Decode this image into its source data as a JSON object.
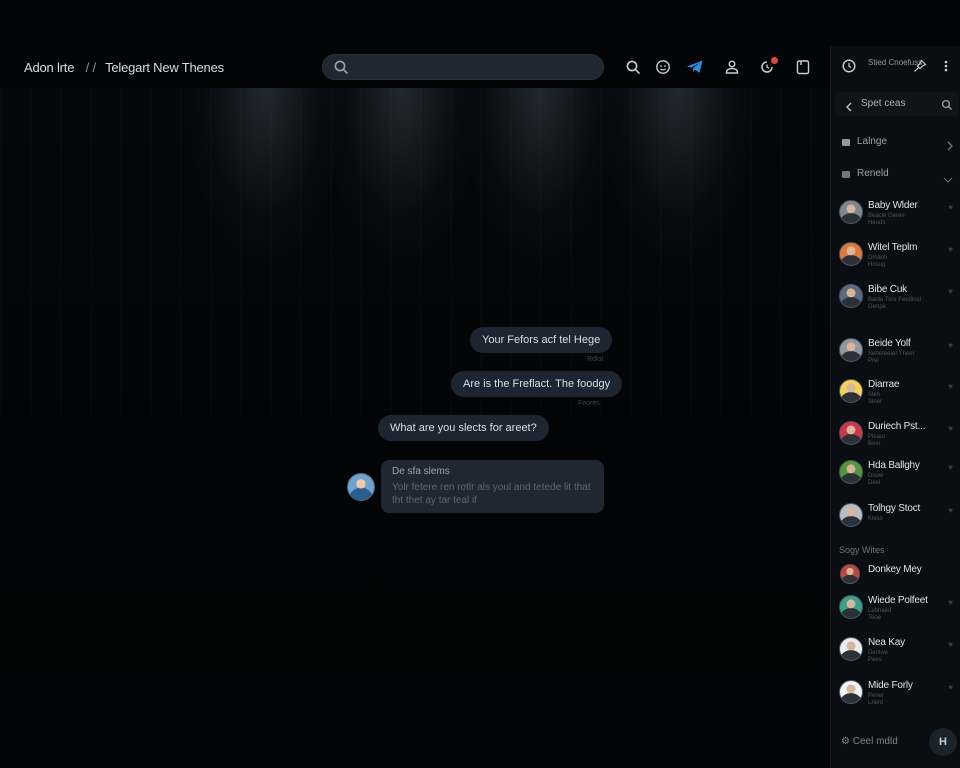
{
  "header": {
    "breadcrumb_root": "Adon lrte",
    "breadcrumb_sep": "/ /",
    "breadcrumb_page": "Telegart New Thenes",
    "search_placeholder": ""
  },
  "toolbar_icons": [
    "search-icon",
    "emoji-icon",
    "telegram-icon",
    "profile-icon",
    "notifications-icon",
    "bookmark-icon"
  ],
  "messages": [
    {
      "text": "Your Fefors acf tel Hege",
      "meta": "Rdlot"
    },
    {
      "text": "Are is the Freflact. The foodgy",
      "meta": "Feores"
    },
    {
      "text": "What are you slects for areet?",
      "meta": ""
    }
  ],
  "received_card": {
    "title": "De sfa slems",
    "body": "Yolr fetere ren rotlr als youl and tetede lit that tht thet ay tar teal if"
  },
  "sidebar": {
    "profile_name": "Stied Cnoefuss",
    "search_label": "Spet ceas",
    "rows": [
      {
        "label": "Lalnge",
        "icon": "chevron-right-icon"
      },
      {
        "label": "Reneld",
        "icon": "chevron-down-icon"
      }
    ],
    "section_label": "Sogy Wites",
    "contacts": [
      {
        "name": "Baby Wlder",
        "sub1": "Beacle Geree",
        "sub2": "Heuds",
        "color": "#7d8792"
      },
      {
        "name": "Witel Teplm",
        "sub1": "Dmanh",
        "sub2": "Hosug",
        "color": "#e07a3a"
      },
      {
        "name": "Bibe Cuk",
        "sub1": "Banle Tore Ferdlinsl",
        "sub2": "Genpe",
        "color": "#5a6b80"
      },
      {
        "name": "Beide Yolf",
        "sub1": "Seheteeter Theer",
        "sub2": "Prel",
        "color": "#8f98a2"
      },
      {
        "name": "Diarrae",
        "sub1": "Slen",
        "sub2": "Siner",
        "color": "#f2d25a"
      },
      {
        "name": "Duriech Pst...",
        "sub1": "Pleaur",
        "sub2": "Beer",
        "color": "#d2344a"
      },
      {
        "name": "Hda Ballghy",
        "sub1": "Dnow",
        "sub2": "Deel",
        "color": "#4f9a3d"
      },
      {
        "name": "Tolhgy Stoct",
        "sub1": "Kless",
        "sub2": "",
        "color": "#b5bec8"
      },
      {
        "name": "Donkey Mey",
        "sub1": "",
        "sub2": "",
        "color": "#c0453a"
      },
      {
        "name": "Wiede Polfeet",
        "sub1": "Lebhaed",
        "sub2": "Teoe",
        "color": "#3aa18a"
      },
      {
        "name": "Nea Kay",
        "sub1": "Denlwe",
        "sub2": "Pees",
        "color": "#e9ecef"
      },
      {
        "name": "Mide Forly",
        "sub1": "Pener",
        "sub2": "Lnent",
        "color": "#f1f3f5"
      }
    ],
    "footer_label": "Ceel mdld",
    "fab_label": "H"
  }
}
